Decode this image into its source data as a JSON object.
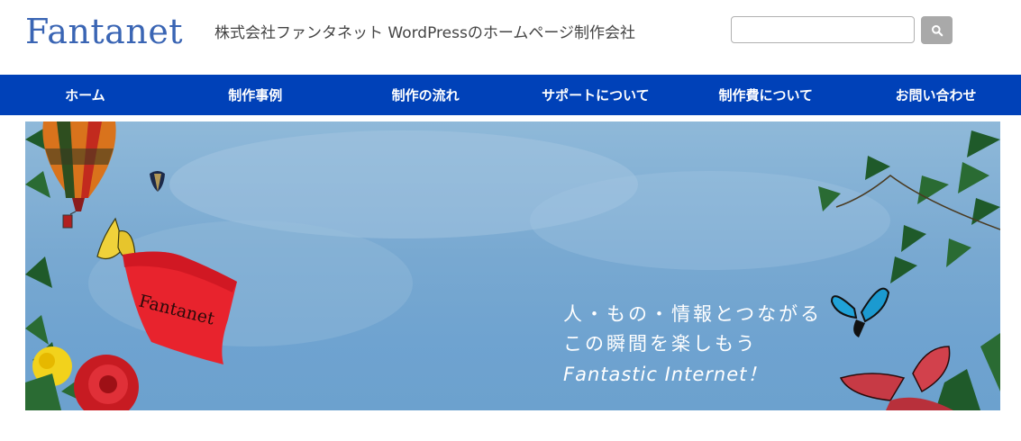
{
  "header": {
    "logo_text": "Fantanet",
    "tagline": "株式会社ファンタネット WordPressのホームページ制作会社",
    "search": {
      "placeholder": "",
      "value": "",
      "button_icon": "search-icon"
    }
  },
  "nav": {
    "items": [
      {
        "label": "ホーム"
      },
      {
        "label": "制作事例"
      },
      {
        "label": "制作の流れ"
      },
      {
        "label": "サポートについて"
      },
      {
        "label": "制作費について"
      },
      {
        "label": "お問い合わせ"
      }
    ]
  },
  "hero": {
    "line1": "人・もの・情報とつながる",
    "line2": "この瞬間を楽しもう",
    "line3": "Fantastic Internet！",
    "flag_text": "Fantanet"
  },
  "colors": {
    "brand_blue": "#0041b8",
    "logo_blue": "#3a65b4",
    "search_button": "#a9a9a9"
  }
}
